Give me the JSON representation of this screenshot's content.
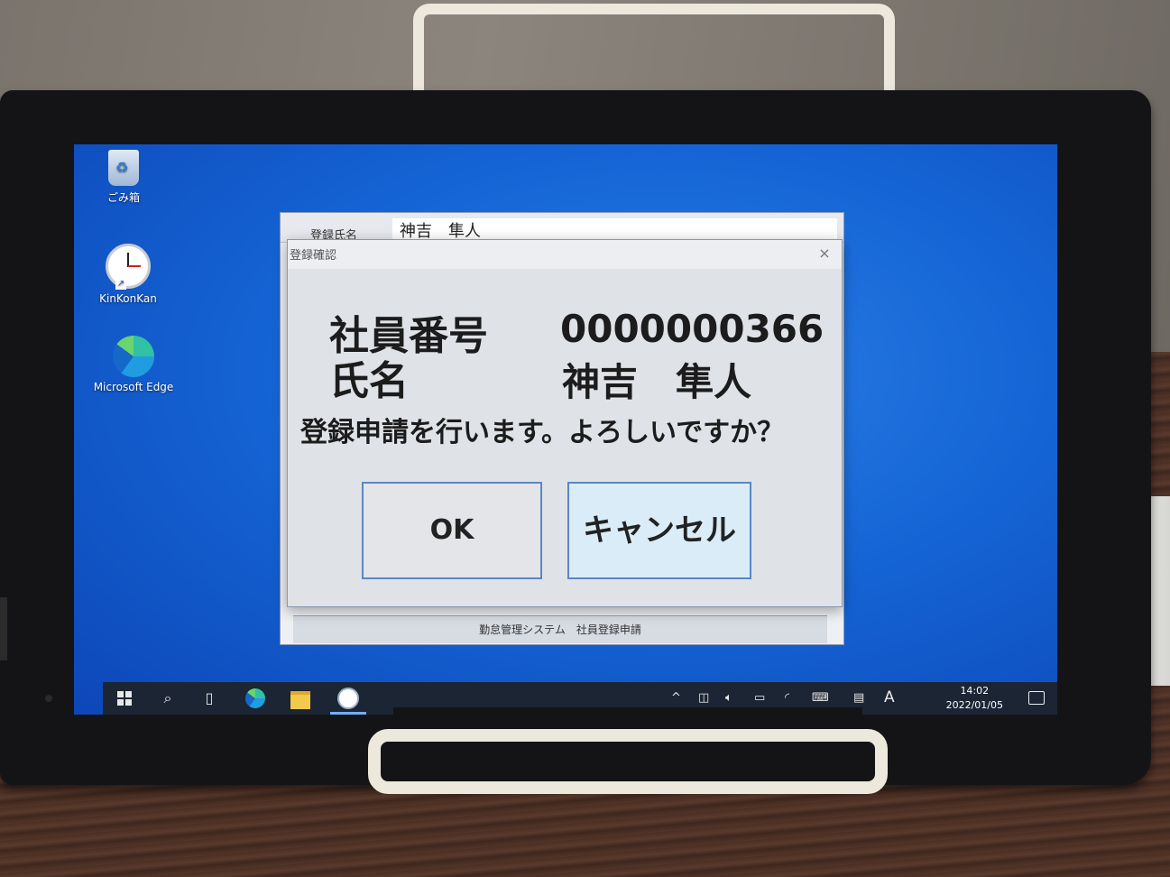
{
  "desktop": {
    "icons": [
      {
        "label": "ごみ箱",
        "icon": "recycle-bin-icon"
      },
      {
        "label": "KinKonKan",
        "icon": "clock-icon"
      },
      {
        "label": "Microsoft Edge",
        "icon": "edge-icon"
      }
    ]
  },
  "background_window": {
    "field_label": "登録氏名",
    "field_value": "神吉　隼人",
    "footer": "勤怠管理システム　社員登録申請"
  },
  "dialog": {
    "title": "登録確認",
    "close_label": "×",
    "employee_number_label": "社員番号",
    "employee_number_value": "0000000366",
    "name_label": "氏名",
    "name_value": "神吉　隼人",
    "question": "登録申請を行います。よろしいですか？",
    "ok_label": "OK",
    "cancel_label": "キャンセル"
  },
  "taskbar": {
    "apps": [
      "start-icon",
      "search-icon",
      "task-view-icon",
      "edge-icon",
      "file-explorer-icon",
      "kinkonkan-icon"
    ],
    "ime_label": "A",
    "time": "14:02",
    "date": "2022/01/05"
  }
}
